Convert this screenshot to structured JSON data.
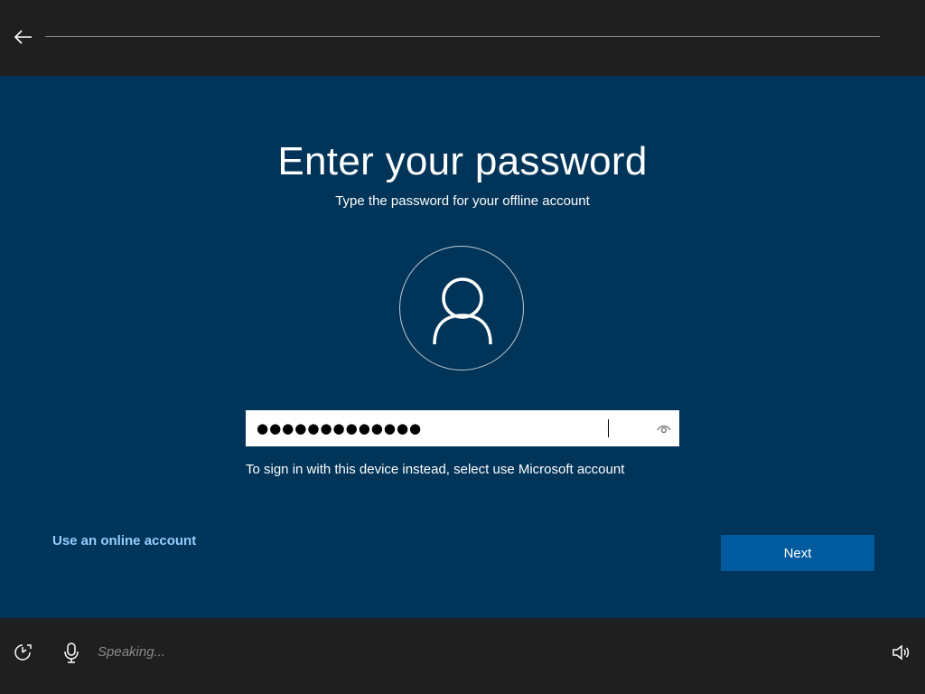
{
  "topbar": {
    "back_icon": "arrow-left-icon"
  },
  "main": {
    "title": "Enter your password",
    "subtitle": "Type the password for your offline account",
    "avatar_icon": "user-icon",
    "password": {
      "value": "●●●●●●●●●●●●●",
      "reveal_icon": "eye-icon"
    },
    "hint": "To sign in with this device instead, select use Microsoft account",
    "online_account_link": "Use an online account",
    "next_button": "Next"
  },
  "bottombar": {
    "ease_icon": "ease-of-access-icon",
    "mic_icon": "microphone-icon",
    "speaking_text": "Speaking...",
    "volume_icon": "volume-icon"
  },
  "colors": {
    "background": "#003459",
    "bars": "#1f1f1f",
    "accent": "#005a9e",
    "link": "#99ccff"
  }
}
